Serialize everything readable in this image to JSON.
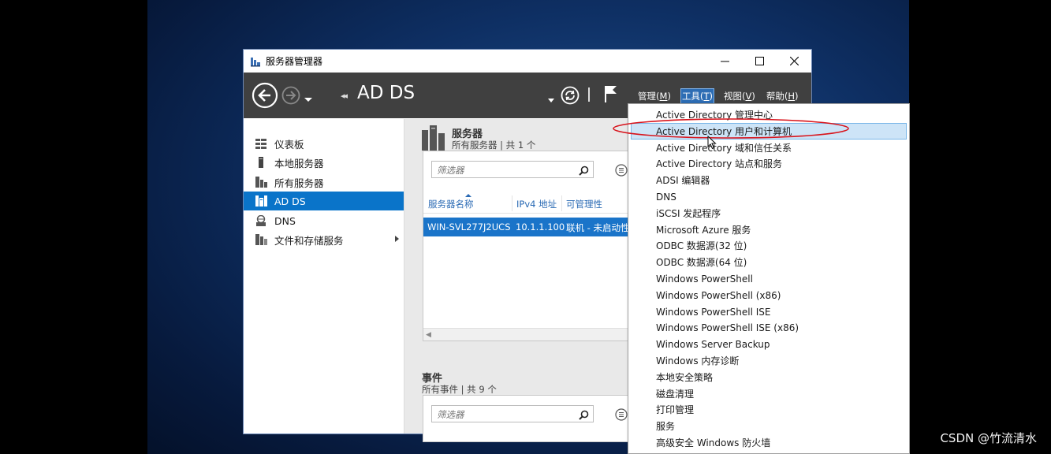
{
  "window": {
    "title": "服务器管理器"
  },
  "toolbar": {
    "breadcrumb_arrows": "◂◂",
    "breadcrumb_title": "AD DS",
    "menus": [
      {
        "label": "管理(",
        "key": "M",
        "suffix": ")"
      },
      {
        "label": "工具(",
        "key": "T",
        "suffix": ")"
      },
      {
        "label": "视图(",
        "key": "V",
        "suffix": ")"
      },
      {
        "label": "帮助(",
        "key": "H",
        "suffix": ")"
      }
    ]
  },
  "sidebar": {
    "items": [
      {
        "label": "仪表板",
        "icon": "dashboard-icon"
      },
      {
        "label": "本地服务器",
        "icon": "local-server-icon"
      },
      {
        "label": "所有服务器",
        "icon": "all-servers-icon"
      },
      {
        "label": "AD DS",
        "icon": "ad-ds-icon",
        "selected": true
      },
      {
        "label": "DNS",
        "icon": "dns-icon"
      },
      {
        "label": "文件和存储服务",
        "icon": "file-storage-icon",
        "has_children": true
      }
    ]
  },
  "servers_section": {
    "title": "服务器",
    "subtitle": "所有服务器 | 共 1 个",
    "filter_placeholder": "筛选器",
    "columns": [
      "服务器名称",
      "IPv4 地址",
      "可管理性"
    ],
    "rows": [
      {
        "name": "WIN-SVL277J2UCS",
        "ipv4": "10.1.1.100",
        "manageability": "联机 - 未启动性"
      }
    ]
  },
  "events_section": {
    "title": "事件",
    "subtitle": "所有事件 | 共 9 个",
    "filter_placeholder": "筛选器"
  },
  "tools_menu": {
    "highlighted_index": 1,
    "items": [
      "Active Directory 管理中心",
      "Active Directory 用户和计算机",
      "Active Directory 域和信任关系",
      "Active Directory 站点和服务",
      "ADSI 编辑器",
      "DNS",
      "iSCSI 发起程序",
      "Microsoft Azure 服务",
      "ODBC 数据源(32 位)",
      "ODBC 数据源(64 位)",
      "Windows PowerShell",
      "Windows PowerShell (x86)",
      "Windows PowerShell ISE",
      "Windows PowerShell ISE (x86)",
      "Windows Server Backup",
      "Windows 内存诊断",
      "本地安全策略",
      "磁盘清理",
      "打印管理",
      "服务",
      "高级安全 Windows 防火墙"
    ]
  },
  "watermark": "CSDN @竹流清水",
  "colors": {
    "toolbar_bg": "#404040",
    "selection_blue": "#0a74c9",
    "menu_highlight": "#cde4f7",
    "annotation_red": "#d8141c"
  }
}
